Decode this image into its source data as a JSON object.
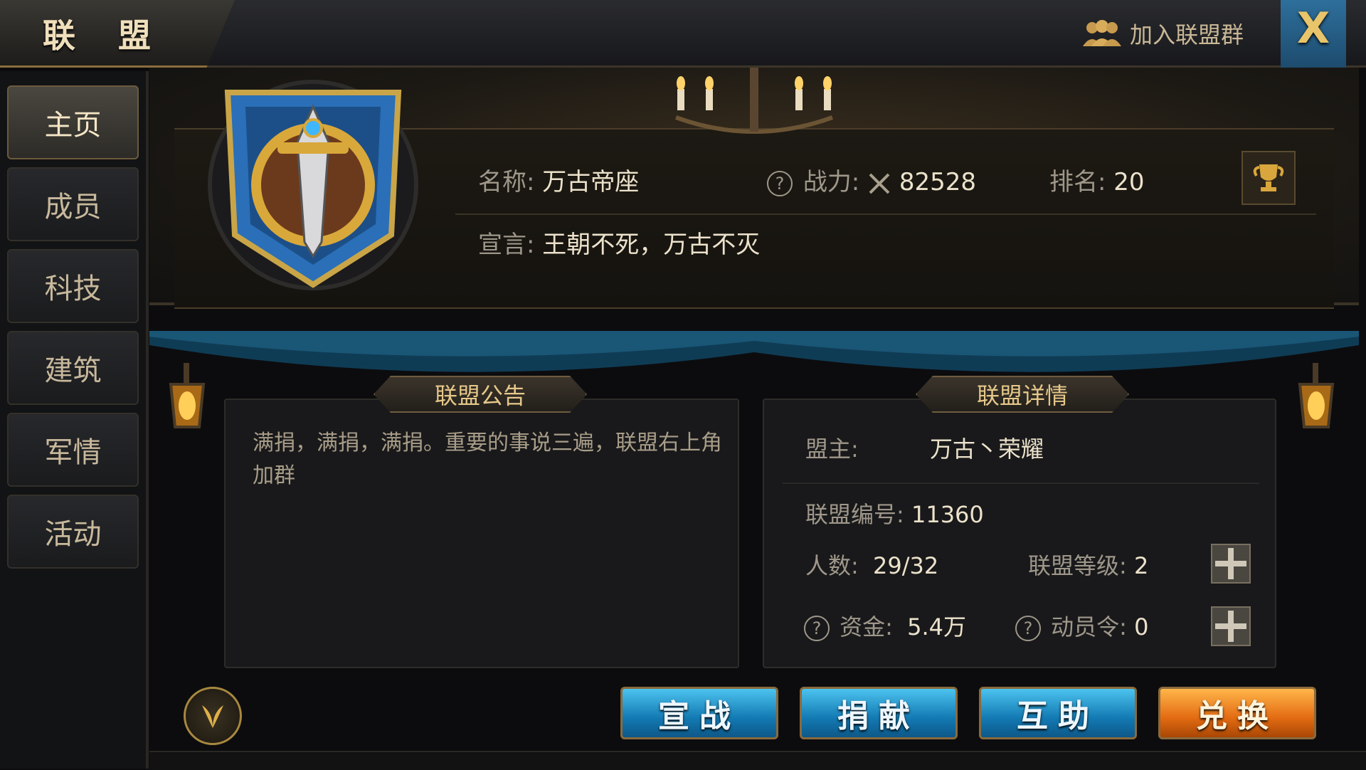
{
  "header": {
    "title": "联 盟",
    "join_group_label": "加入联盟群",
    "close_label": "X"
  },
  "sidebar": {
    "items": [
      {
        "label": "主页",
        "active": true
      },
      {
        "label": "成员"
      },
      {
        "label": "科技"
      },
      {
        "label": "建筑"
      },
      {
        "label": "军情"
      },
      {
        "label": "活动"
      }
    ]
  },
  "alliance": {
    "name_label": "名称:",
    "name": "万古帝座",
    "power_label": "战力:",
    "power": "82528",
    "rank_label": "排名:",
    "rank": "20",
    "declaration_label": "宣言:",
    "declaration": "王朝不死，万古不灭"
  },
  "notice": {
    "title": "联盟公告",
    "text": "满捐，满捐，满捐。重要的事说三遍，联盟右上角加群"
  },
  "details": {
    "title": "联盟详情",
    "leader_label": "盟主:",
    "leader": "万古丶荣耀",
    "id_label": "联盟编号:",
    "id": "11360",
    "members_label": "人数:",
    "members": "29/32",
    "level_label": "联盟等级:",
    "level": "2",
    "funds_label": "资金:",
    "funds": "5.4万",
    "mobilize_label": "动员令:",
    "mobilize": "0"
  },
  "actions": {
    "declare_war": "宣战",
    "donate": "捐献",
    "help": "互助",
    "exchange": "兑换"
  },
  "colors": {
    "accent_gold": "#e6c88a",
    "button_blue": "#137ab3",
    "button_orange": "#e36b12"
  },
  "icons": [
    "group-icon",
    "close-icon",
    "alliance-emblem-icon",
    "chandelier-icon",
    "question-icon",
    "crossed-swords-icon",
    "trophy-icon",
    "plus-icon",
    "lantern-icon",
    "round-emblem-icon"
  ]
}
